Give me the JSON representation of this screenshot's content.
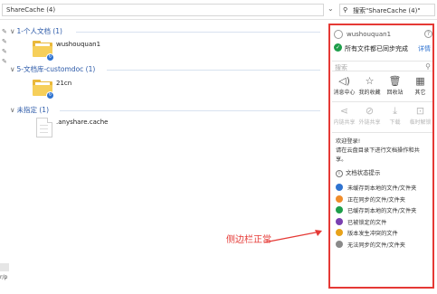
{
  "address": {
    "path": "ShareCache (4)",
    "search_placeholder": "搜索\"ShareCache (4)\""
  },
  "groups": [
    {
      "title": "1-个人文档 (1)",
      "item": "wushouquan1"
    },
    {
      "title": "5-文档库-customdoc (1)",
      "item": "21cn"
    },
    {
      "title": "未指定 (1)",
      "item": ".anyshare.cache"
    }
  ],
  "sidebar": {
    "username": "wushouquan1",
    "help": "?",
    "status": "所有文件都已同步完成",
    "detail": "详情",
    "search_placeholder": "搜索",
    "tools_row1": [
      {
        "icon": "message-icon",
        "glyph": "◁)",
        "label": "消息中心"
      },
      {
        "icon": "star-icon",
        "glyph": "☆",
        "label": "我的收藏"
      },
      {
        "icon": "trash-icon",
        "glyph": "🗑",
        "label": "回收站"
      },
      {
        "icon": "grid-icon",
        "glyph": "▦",
        "label": "其它"
      }
    ],
    "tools_row2": [
      {
        "icon": "share-icon",
        "glyph": "⋖",
        "label": "内链共享"
      },
      {
        "icon": "link-icon",
        "glyph": "⊘",
        "label": "外链共享"
      },
      {
        "icon": "download-icon",
        "glyph": "⤓",
        "label": "下载"
      },
      {
        "icon": "unlock-icon",
        "glyph": "⊡",
        "label": "临时解锁"
      }
    ],
    "welcome_title": "欢迎登录!",
    "welcome_body": "请在云盘目录下进行文档操作和共享。",
    "status_title": "文档状态提示",
    "legend": [
      {
        "color": "#2f73d0",
        "text": "未缓存到本地的文件/文件夹"
      },
      {
        "color": "#f08c2a",
        "text": "正在同步的文件/文件夹"
      },
      {
        "color": "#1e9e4a",
        "text": "已缓存到本地的文件/文件夹"
      },
      {
        "color": "#7a3fb0",
        "text": "已被锁定的文件"
      },
      {
        "color": "#e8a21a",
        "text": "版本发生冲突的文件"
      },
      {
        "color": "#8a8a8a",
        "text": "无法同步的文件/文件夹"
      }
    ]
  },
  "annotation": "侧边栏正常",
  "bottom_fragment": "r/p"
}
